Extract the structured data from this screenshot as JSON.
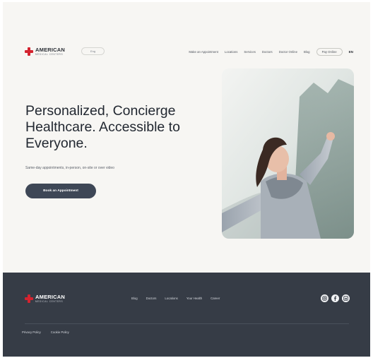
{
  "brand": {
    "name": "AMERICAN",
    "subtitle": "MEDICAL CENTERS",
    "color": "#d4232f"
  },
  "header": {
    "language_select": "Eng",
    "nav": [
      "Make an Appointment",
      "Locations",
      "Services",
      "Doctors",
      "Doctor Online",
      "Blog"
    ],
    "pay_button": "Pay Online",
    "lang_toggle": "EN"
  },
  "hero": {
    "title": "Personalized, Concierge Healthcare. Accessible to Everyone.",
    "subtitle": "Same-day appointments, in-person, on-site or over video",
    "cta": "Book an Appointment",
    "image_alt": "woman-with-outstretched-arms"
  },
  "footer": {
    "nav": [
      "Blog",
      "Doctors",
      "Locations",
      "Your Health",
      "Career"
    ],
    "social_icons": [
      "instagram-icon",
      "facebook-icon",
      "linkedin-icon"
    ],
    "legal": [
      "Privacy Policy",
      "Cookie Policy"
    ],
    "background": "#363c46"
  },
  "colors": {
    "page_background": "#f7f6f3",
    "cta_background": "#3e4756"
  }
}
